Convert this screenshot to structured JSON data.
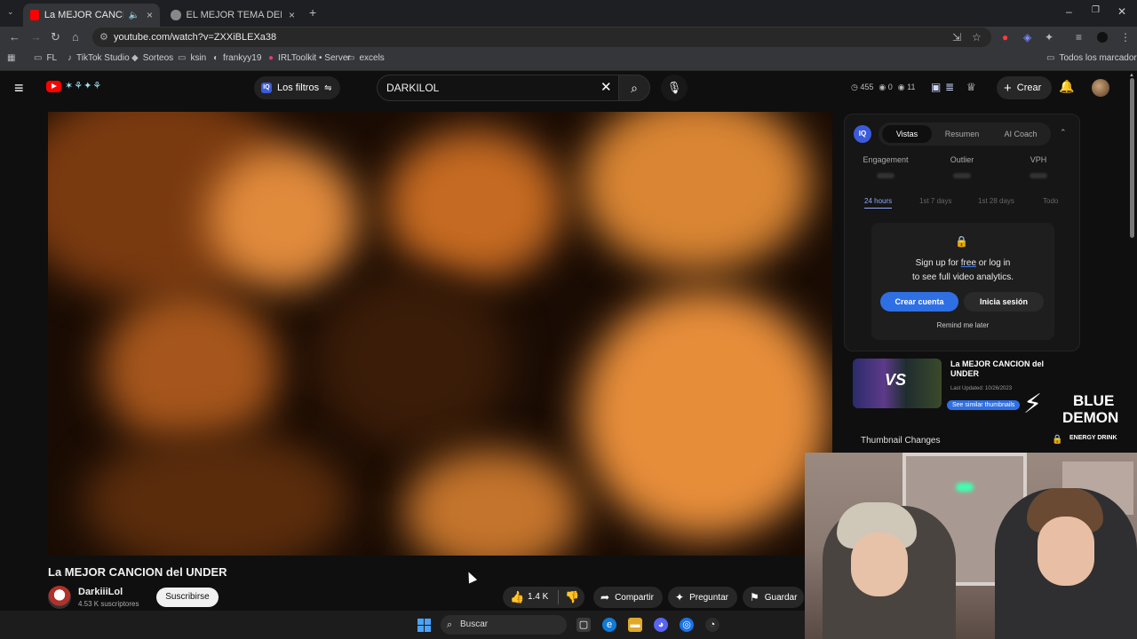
{
  "browser": {
    "tabs": [
      {
        "title": "La MEJOR CANCION del UNDER",
        "active": true
      },
      {
        "title": "EL MEJOR TEMA DEL UNDER B",
        "active": false
      }
    ],
    "url": "youtube.com/watch?v=ZXXiBLEXa38",
    "bookmarks": [
      "FL",
      "TikTok Studio",
      "Sorteos",
      "ksin",
      "frankyy19",
      "IRLToolkit • Server",
      "excels"
    ],
    "all_bookmarks": "Todos los marcadores"
  },
  "yt": {
    "filters_label": "Los filtros",
    "search_value": "DARKILOL",
    "stats": {
      "views": "455",
      "a": "0",
      "b": "11"
    },
    "create_label": "Crear"
  },
  "panel": {
    "tabs": [
      "Vistas",
      "Resumen",
      "AI Coach"
    ],
    "metrics": [
      "Engagement",
      "Outlier",
      "VPH"
    ],
    "ranges": [
      "24 hours",
      "1st 7 days",
      "1st 28 days",
      "Todo"
    ],
    "lock_msg_prefix": "Sign up for ",
    "lock_msg_free": "free",
    "lock_msg_suffix": " or log in",
    "lock_msg_line2": "to see full video analytics.",
    "create_account": "Crear cuenta",
    "login": "Inicia sesión",
    "remind": "Remind me later"
  },
  "suggestion": {
    "title": "La MEJOR CANCION del UNDER",
    "updated": "Last Updated: 10/26/2023",
    "similar": "See similar thumbnails",
    "thumb_text": "VS"
  },
  "thumbnail_changes": "Thumbnail Changes",
  "sponsor": {
    "line1": "BLUE",
    "line2": "DEMON",
    "line3": "ENERGY DRINK"
  },
  "video": {
    "title": "La MEJOR CANCION del UNDER",
    "channel": "DarkiiiLol",
    "subs": "4.53 K suscriptores",
    "subscribe": "Suscribirse",
    "likes": "1.4 K",
    "share": "Compartir",
    "ask": "Preguntar",
    "save": "Guardar"
  },
  "taskbar": {
    "search": "Buscar"
  },
  "colors": {
    "accent": "#2f6fe4",
    "yt_red": "#ff0000",
    "bg": "#0f0f0f"
  }
}
